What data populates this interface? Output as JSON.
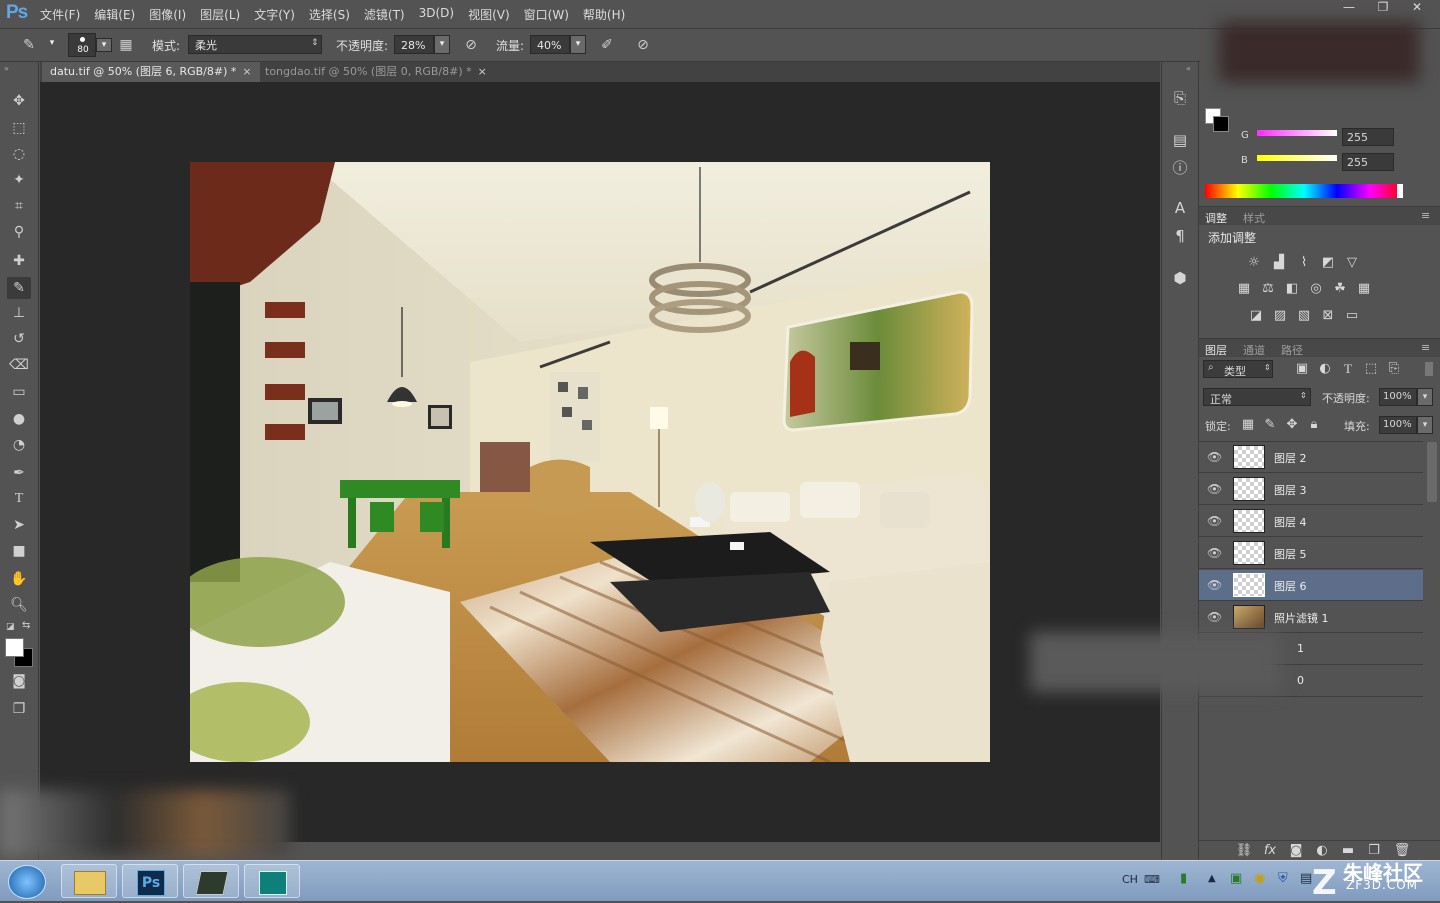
{
  "app": {
    "logo": "Ps"
  },
  "menu": [
    "文件(F)",
    "编辑(E)",
    "图像(I)",
    "图层(L)",
    "文字(Y)",
    "选择(S)",
    "滤镜(T)",
    "3D(D)",
    "视图(V)",
    "窗口(W)",
    "帮助(H)"
  ],
  "window_controls": {
    "minimize": "—",
    "restore": "❐",
    "close": "✕"
  },
  "options": {
    "brush_size": "80",
    "mode_label": "模式:",
    "mode_value": "柔光",
    "opacity_label": "不透明度:",
    "opacity_value": "28%",
    "flow_label": "流量:",
    "flow_value": "40%"
  },
  "tabs": [
    {
      "label": "datu.tif @ 50% (图层 6, RGB/8#) *",
      "active": true
    },
    {
      "label": "tongdao.tif @ 50% (图层 0, RGB/8#) *",
      "active": false
    }
  ],
  "color_panel": {
    "g_label": "G",
    "g_value": "255",
    "b_label": "B",
    "b_value": "255"
  },
  "adjustments": {
    "tab_adjust": "调整",
    "tab_style": "样式",
    "add_label": "添加调整"
  },
  "layers_panel": {
    "tab_layers": "图层",
    "tab_channels": "通道",
    "tab_paths": "路径",
    "filter_kind": "类型",
    "blend_mode": "正常",
    "opacity_label": "不透明度:",
    "opacity_value": "100%",
    "lock_label": "锁定:",
    "fill_label": "填充:",
    "fill_value": "100%",
    "layers": [
      {
        "name": "图层 2",
        "selected": false
      },
      {
        "name": "图层 3",
        "selected": false
      },
      {
        "name": "图层 4",
        "selected": false
      },
      {
        "name": "图层 5",
        "selected": false
      },
      {
        "name": "图层 6",
        "selected": true
      },
      {
        "name": "照片滤镜 1",
        "selected": false
      },
      {
        "name": "1",
        "selected": false
      },
      {
        "name": "0",
        "selected": false
      }
    ]
  },
  "taskbar": {
    "lang": "CH",
    "ps_label": "Ps"
  },
  "watermark": {
    "site_name": "朱峰社区",
    "site_url": "ZF3D.COM"
  },
  "colors": {
    "accent": "#5fa8e6",
    "selection": "#5d6e8a",
    "canvas_bg": "#282828",
    "panel_bg": "#535353"
  }
}
